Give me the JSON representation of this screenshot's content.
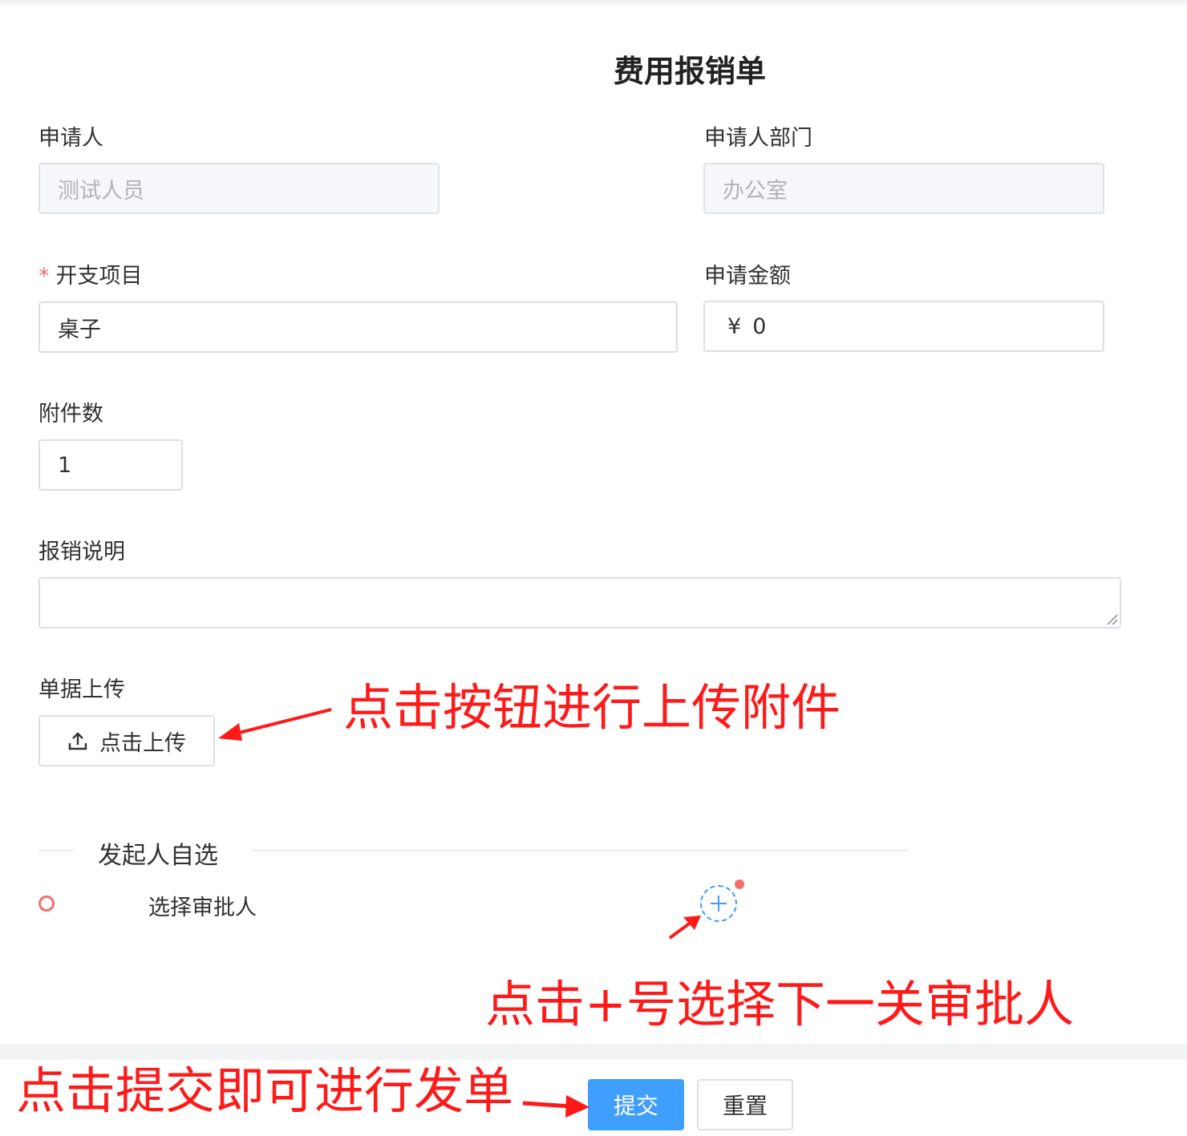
{
  "form": {
    "title": "费用报销单",
    "applicant": {
      "label": "申请人",
      "value": "测试人员"
    },
    "department": {
      "label": "申请人部门",
      "value": "办公室"
    },
    "expense_item": {
      "required_mark": "*",
      "label": "开支项目",
      "value": "桌子"
    },
    "amount": {
      "label": "申请金额",
      "currency": "¥",
      "value": "0"
    },
    "attachments": {
      "label": "附件数",
      "value": "1"
    },
    "description": {
      "label": "报销说明",
      "value": ""
    },
    "upload": {
      "label": "单据上传",
      "button_label": "点击上传"
    }
  },
  "approval": {
    "section_title": "发起人自选",
    "step_label": "选择审批人"
  },
  "actions": {
    "submit": "提交",
    "reset": "重置"
  },
  "annotations": {
    "upload_hint": "点击按钮进行上传附件",
    "approver_hint": "点击+号选择下一关审批人",
    "submit_hint": "点击提交即可进行发单"
  },
  "colors": {
    "primary": "#409eff",
    "danger": "#f56c6c",
    "annotation": "#ff1a1a"
  }
}
